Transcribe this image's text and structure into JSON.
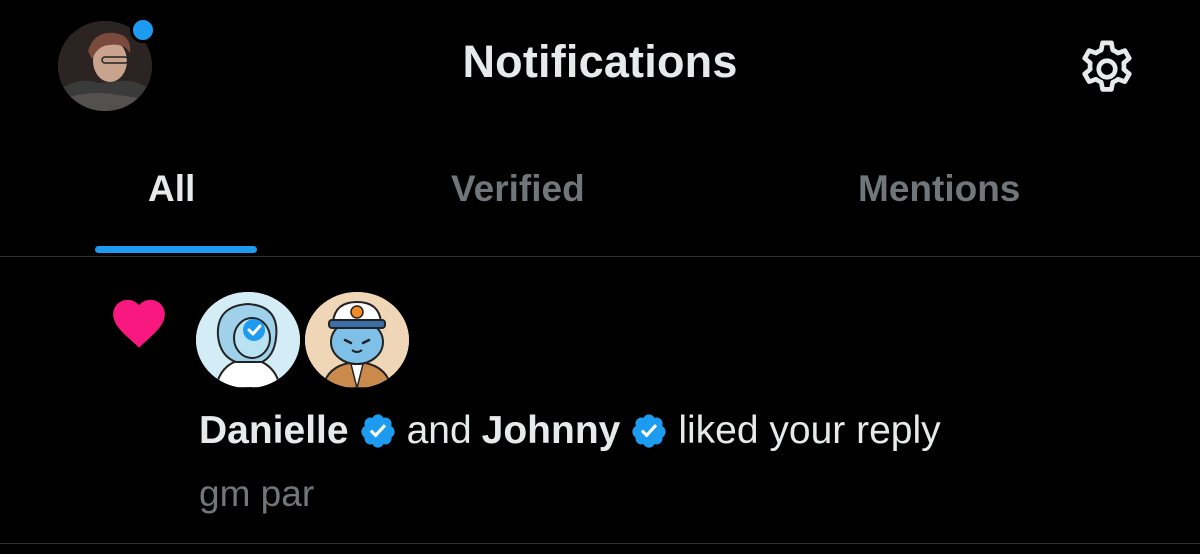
{
  "header": {
    "title": "Notifications",
    "settings_icon": "gear-icon",
    "profile_avatar": "profile-avatar",
    "has_unread_dot": true
  },
  "tabs": [
    {
      "label": "All",
      "active": true
    },
    {
      "label": "Verified",
      "active": false
    },
    {
      "label": "Mentions",
      "active": false
    }
  ],
  "notification": {
    "type_icon": "heart-icon",
    "users": [
      {
        "name": "Danielle",
        "verified": true
      },
      {
        "name": "Johnny",
        "verified": true
      }
    ],
    "connector": "and",
    "action": "liked your reply",
    "preview": "gm par"
  },
  "colors": {
    "background": "#000000",
    "accent": "#1d9bf0",
    "heart": "#f91880",
    "text_primary": "#e7e9ea",
    "text_secondary": "#71767b",
    "divider": "#2f3336"
  }
}
